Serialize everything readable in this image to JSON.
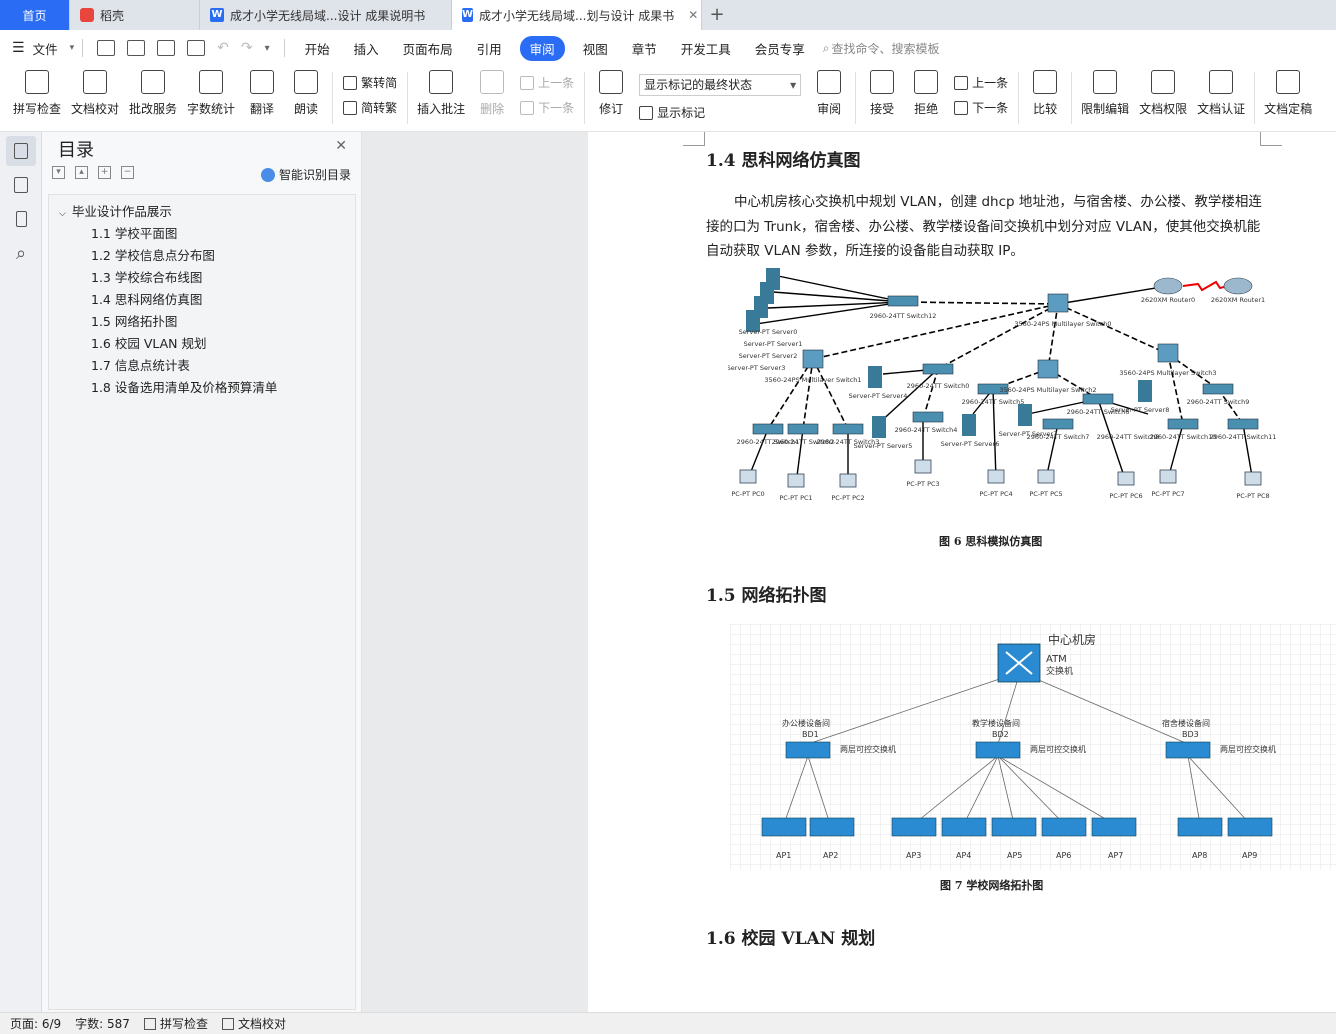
{
  "tabs": [
    {
      "label": "首页"
    },
    {
      "label": "稻壳"
    },
    {
      "label": "成才小学无线局域...设计 成果说明书"
    },
    {
      "label": "成才小学无线局域...划与设计 成果书"
    }
  ],
  "menu": {
    "file": "文件",
    "items": [
      "开始",
      "插入",
      "页面布局",
      "引用",
      "审阅",
      "视图",
      "章节",
      "开发工具",
      "会员专享"
    ],
    "search": "查找命令、搜索模板"
  },
  "ribbon": {
    "spell": "拼写检查",
    "proof": "文档校对",
    "batch": "批改服务",
    "wordcount": "字数统计",
    "translate": "翻译",
    "read": "朗读",
    "t2s": "繁转简",
    "s2t": "简转繁",
    "add_comment": "插入批注",
    "delete": "删除",
    "prev": "上一条",
    "next": "下一条",
    "revise": "修订",
    "display_select": "显示标记的最终状态",
    "show_marks": "显示标记",
    "review": "审阅",
    "accept": "接受",
    "reject": "拒绝",
    "prev2": "上一条",
    "next2": "下一条",
    "compare": "比较",
    "restrict": "限制编辑",
    "rights": "文档权限",
    "certify": "文档认证",
    "finalize": "文档定稿"
  },
  "toc": {
    "title": "目录",
    "smart": "智能识别目录",
    "root": "毕业设计作品展示",
    "items": [
      "1.1  学校平面图",
      "1.2  学校信息点分布图",
      "1.3  学校综合布线图",
      "1.4  思科网络仿真图",
      "1.5  网络拓扑图",
      "1.6  校园 VLAN 规划",
      "1.7  信息点统计表",
      "1.8  设备选用清单及价格预算清单"
    ]
  },
  "doc": {
    "h14": "1.4 思科网络仿真图",
    "para": "中心机房核心交换机中规划 VLAN，创建 dhcp 地址池，与宿舍楼、办公楼、教学楼相连接的口为 Trunk，宿舍楼、办公楼、教学楼设备间交换机中划分对应 VLAN，使其他交换机能自动获取 VLAN 参数，所连接的设备能自动获取 IP。",
    "fig6": "图 6  思科模拟仿真图",
    "h15": "1.5 网络拓扑图",
    "fig7": "图 7  学校网络拓扑图",
    "h16": "1.6 校园 VLAN 规划"
  },
  "fig6_labels": {
    "servers": [
      "Server-PT Server0",
      "Server-PT Server1",
      "Server-PT Server2",
      "Server-PT Server3",
      "Server-PT Server4",
      "Server-PT Server5",
      "Server-PT Server6",
      "Server-PT Server7",
      "Server-PT Server8"
    ],
    "switch12": "2960-24TT Switch12",
    "ms0": "3560-24PS Multilayer Switch0",
    "ms1": "3560-24PS Multilayer Switch1",
    "ms2": "3560-24PS Multilayer Switch2",
    "ms3": "3560-24PS Multilayer Switch3",
    "r0": "2620XM Router0",
    "r1": "2620XM Router1",
    "switches": [
      "2960-24TT Switch0",
      "2960-24TT Switch1",
      "2960-24TT Switch2",
      "2960-24TT Switch3",
      "2960-24TT Switch4",
      "2960-24TT Switch5",
      "2960-24TT Switch6",
      "2960-24TT Switch7",
      "2960-24TT Switch8",
      "2960-24TT Switch9",
      "2960-24TT Switch10",
      "2960-24TT Switch11"
    ],
    "pcs": [
      "PC-PT PC0",
      "PC-PT PC1",
      "PC-PT PC2",
      "PC-PT PC3",
      "PC-PT PC4",
      "PC-PT PC5",
      "PC-PT PC6",
      "PC-PT PC7",
      "PC-PT PC8"
    ]
  },
  "fig7_labels": {
    "center": "中心机房",
    "atm": "ATM",
    "core": "交换机",
    "bd1": "办公楼设备间",
    "bd1c": "BD1",
    "bd2": "教学楼设备间",
    "bd2c": "BD2",
    "bd3": "宿舍楼设备间",
    "bd3c": "BD3",
    "l3": "两层可控交换机",
    "aps": [
      "AP1",
      "AP2",
      "AP3",
      "AP4",
      "AP5",
      "AP6",
      "AP7",
      "AP8",
      "AP9"
    ]
  },
  "status": {
    "page": "页面: 6/9",
    "words": "字数: 587",
    "spell": "拼写检查",
    "proof": "文档校对"
  }
}
